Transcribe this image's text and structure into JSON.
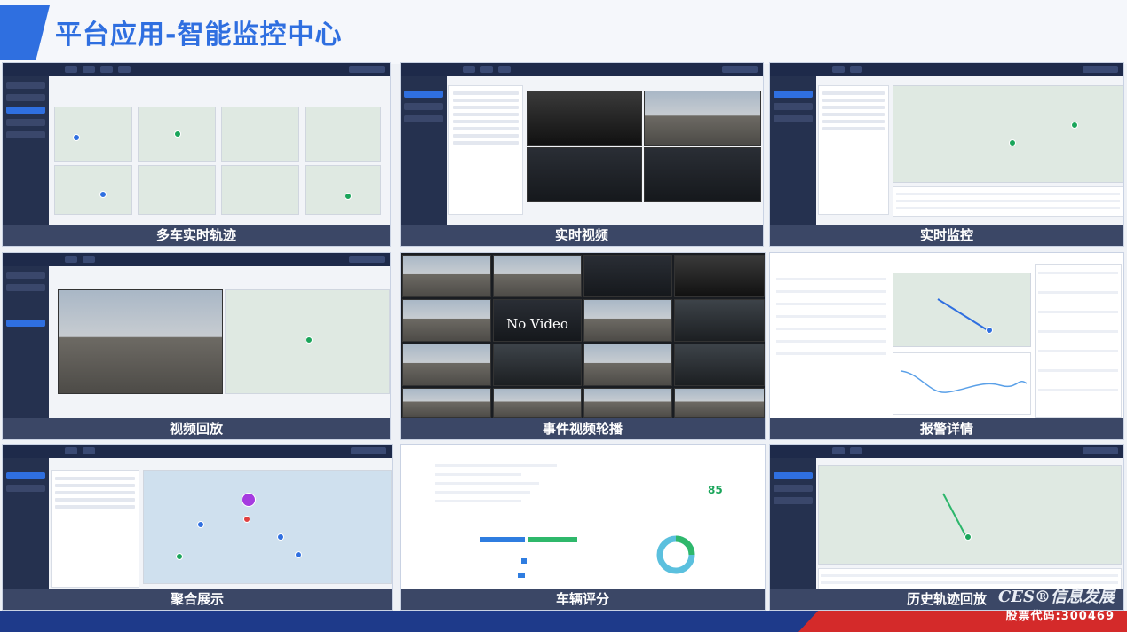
{
  "header": {
    "title": "平台应用-智能监控中心"
  },
  "panels": {
    "multi_track": {
      "caption": "多车实时轨迹"
    },
    "live_video": {
      "caption": "实时视频"
    },
    "live_monitor": {
      "caption": "实时监控"
    },
    "playback": {
      "caption": "视频回放"
    },
    "event_carousel": {
      "caption": "事件视频轮播",
      "no_video_label": "No Video"
    },
    "alarm_detail": {
      "caption": "报警详情"
    },
    "cluster": {
      "caption": "聚合展示"
    },
    "vehicle_score": {
      "caption": "车辆评分",
      "score_value": "85"
    },
    "history_track": {
      "caption": "历史轨迹回放"
    }
  },
  "footer": {
    "logo": "CES®信息发展",
    "stock": "股票代码:300469"
  },
  "colors": {
    "accent": "#2f6fe0",
    "caption_bg": "#3b4766",
    "footer_blue": "#1e3a8a",
    "footer_red": "#d42a2a"
  }
}
